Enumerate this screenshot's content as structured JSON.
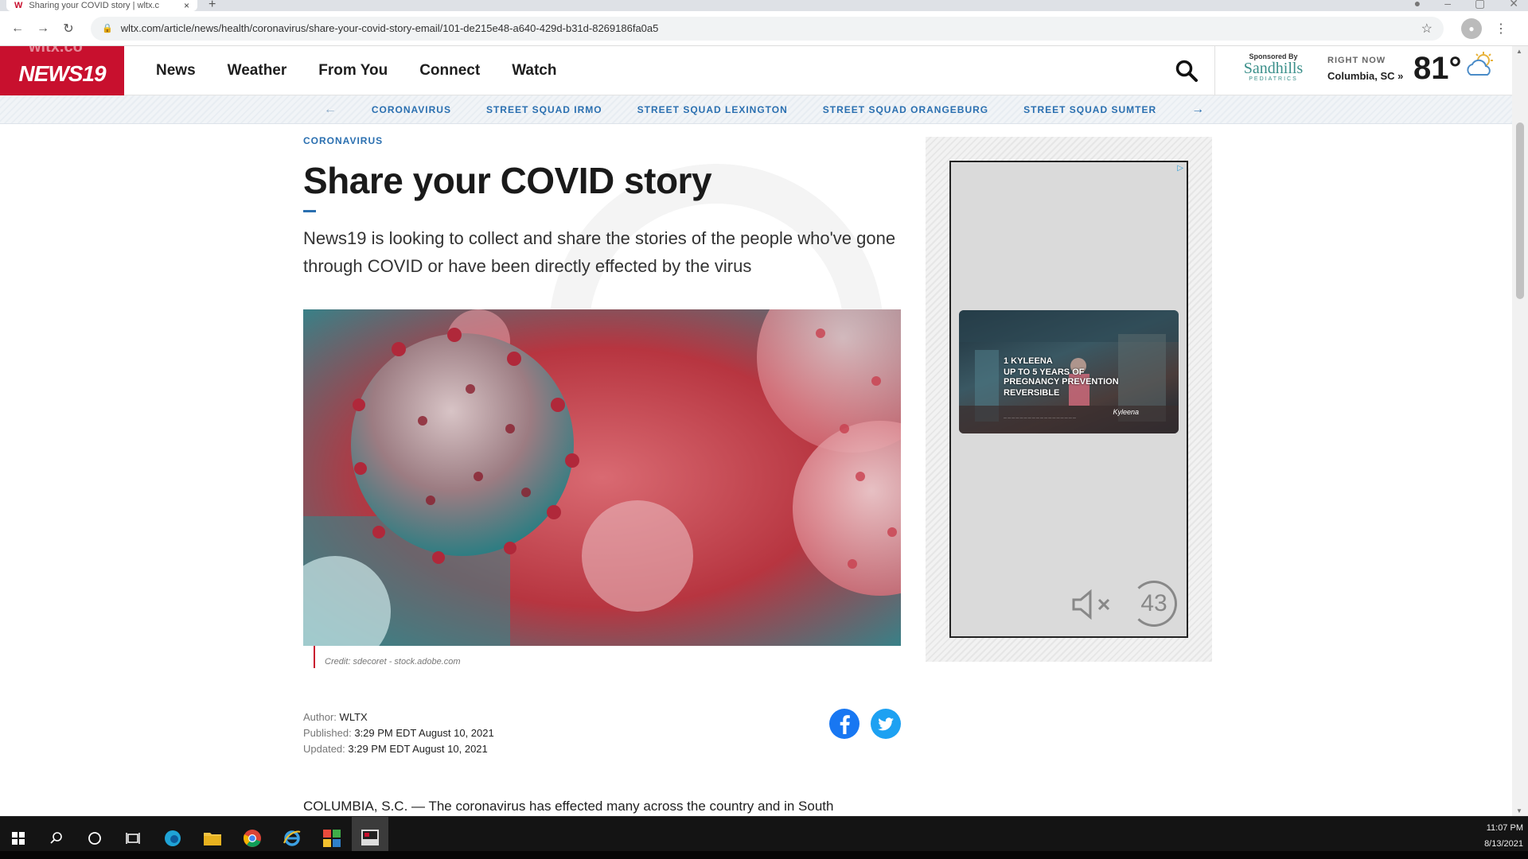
{
  "browser": {
    "tab_title": "Sharing your COVID story | wltx.c",
    "tab_close": "×",
    "new_tab": "+",
    "url": "wltx.com/article/news/health/coronavirus/share-your-covid-story-email/101-de215e48-a640-429d-b31d-8269186fa0a5"
  },
  "site": {
    "logo_ghost": "wltx.co",
    "logo": "NEWS19",
    "nav": [
      "News",
      "Weather",
      "From You",
      "Connect",
      "Watch"
    ],
    "sponsor_label": "Sponsored By",
    "sponsor_name": "Sandhills",
    "sponsor_sub": "PEDIATRICS",
    "weather_label": "RIGHT NOW",
    "weather_location": "Columbia, SC »",
    "temperature": "81°"
  },
  "subnav": {
    "items": [
      "CORONAVIRUS",
      "STREET SQUAD IRMO",
      "STREET SQUAD LEXINGTON",
      "STREET SQUAD ORANGEBURG",
      "STREET SQUAD SUMTER"
    ]
  },
  "article": {
    "kicker": "CORONAVIRUS",
    "headline": "Share your COVID story",
    "dek": "News19 is looking to collect and share the stories of the people who've gone through COVID or have been directly effected by the virus",
    "credit": "Credit: sdecoret - stock.adobe.com",
    "author_label": "Author:",
    "author": "WLTX",
    "published_label": "Published:",
    "published": "3:29 PM EDT August 10, 2021",
    "updated_label": "Updated:",
    "updated": "3:29 PM EDT August 10, 2021",
    "body_start": "COLUMBIA, S.C. — The coronavirus has effected many across the country and in South"
  },
  "ad": {
    "line1": "1 KYLEENA",
    "line2": "UP TO 5 YEARS OF",
    "line3": "PREGNANCY PREVENTION",
    "line4": "REVERSIBLE",
    "brand": "Kyleena",
    "countdown": "43"
  },
  "taskbar": {
    "time": "11:07 PM",
    "date": "8/13/2021"
  },
  "colors": {
    "brand_red": "#c8102e",
    "link_blue": "#2a6fb0",
    "facebook": "#1877f2",
    "twitter": "#1da1f2"
  }
}
